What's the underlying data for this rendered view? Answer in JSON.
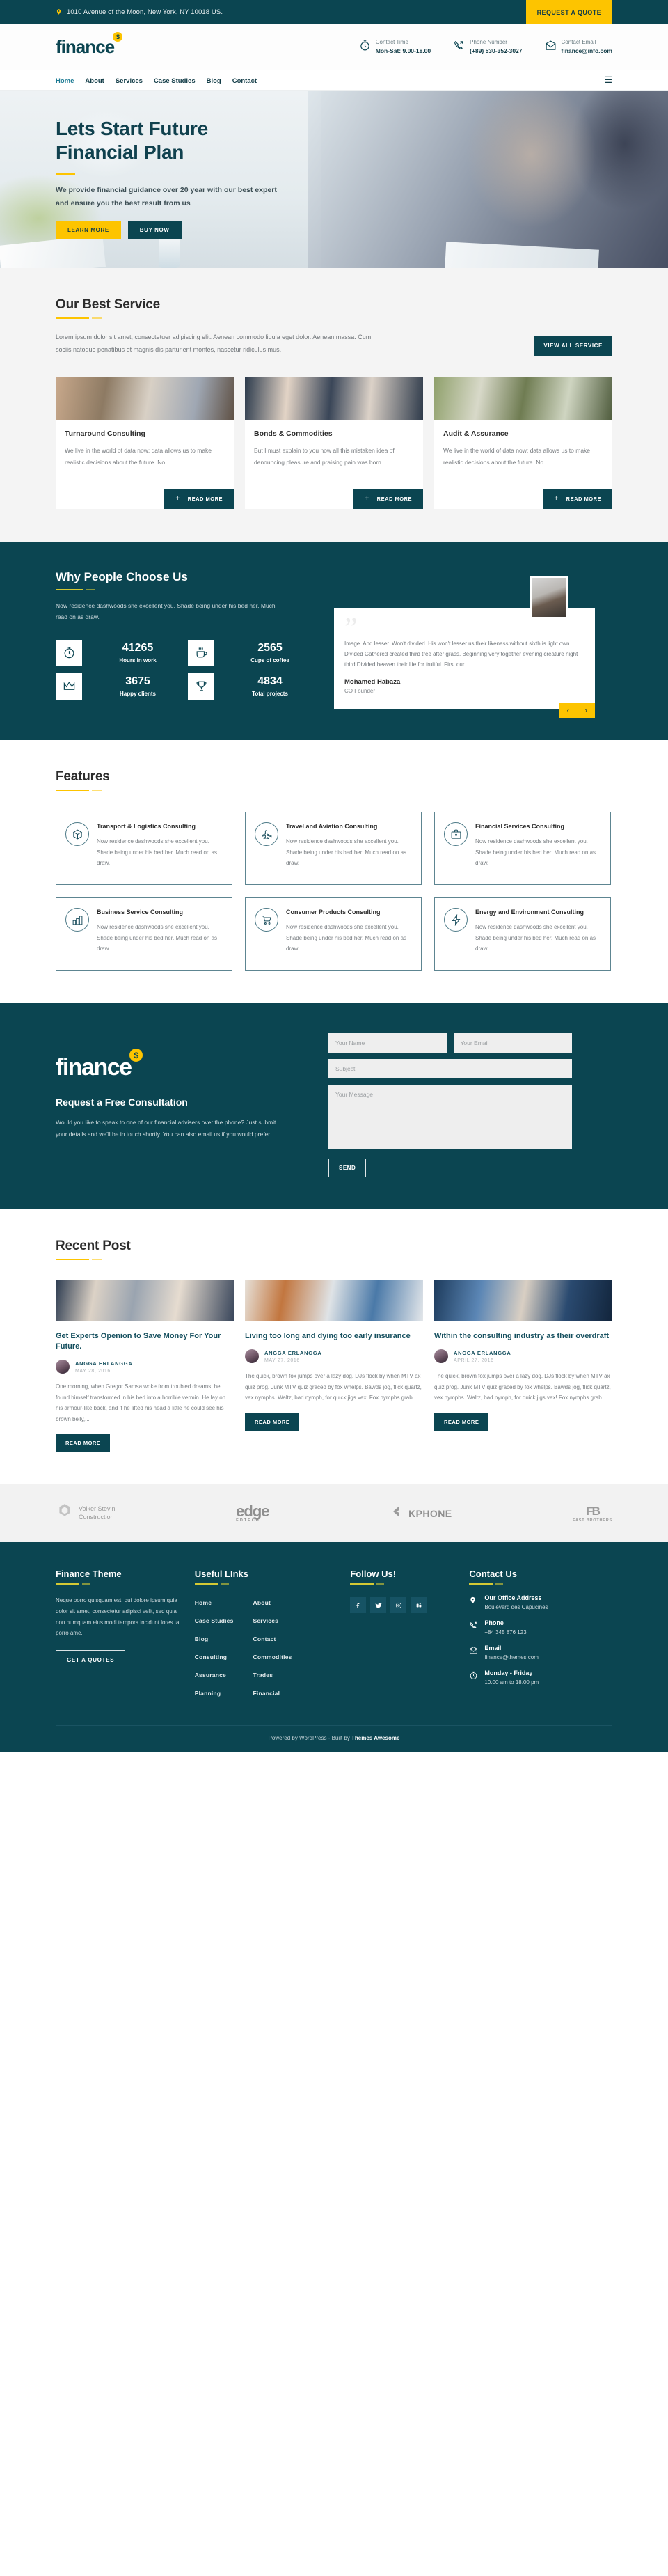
{
  "topbar": {
    "address": "1010 Avenue of the Moon, New York, NY 10018 US.",
    "quote_button": "REQUEST A QUOTE"
  },
  "header": {
    "logo": "finance",
    "logo_coin": "$",
    "contacts": [
      {
        "icon": "clock-icon",
        "label": "Contact Time",
        "value": "Mon-Sat: 9.00-18.00"
      },
      {
        "icon": "phone-icon",
        "label": "Phone Number",
        "value": "(+89) 530-352-3027"
      },
      {
        "icon": "envelope-icon",
        "label": "Contact Email",
        "value": "finance@info.com"
      }
    ]
  },
  "nav": {
    "items": [
      "Home",
      "About",
      "Services",
      "Case Studies",
      "Blog",
      "Contact"
    ],
    "active": "Home",
    "menu_icon": "hamburger-icon"
  },
  "hero": {
    "title_line1": "Lets Start Future",
    "title_line2": "Financial Plan",
    "paragraph": "We provide financial guidance over 20 year with our best expert and ensure you the best result from us",
    "btn_primary": "LEARN MORE",
    "btn_secondary": "BUY NOW"
  },
  "best_service": {
    "title": "Our Best Service",
    "paragraph": "Lorem ipsum dolor sit amet, consectetuer adipiscing elit. Aenean commodo ligula eget dolor. Aenean massa. Cum sociis natoque penatibus et magnis dis parturient montes, nascetur ridiculus mus.",
    "view_all": "VIEW ALL SERVICE",
    "read_more": "READ MORE",
    "cards": [
      {
        "title": "Turnaround Consulting",
        "text": "We live in the world of data now; data allows us to make realistic decisions about the future. No..."
      },
      {
        "title": "Bonds & Commodities",
        "text": "But I must explain to you how all this mistaken idea of denouncing pleasure and praising pain was born..."
      },
      {
        "title": "Audit & Assurance",
        "text": "We live in the world of data now; data allows us to make realistic decisions about the future. No..."
      }
    ]
  },
  "why_choose": {
    "title": "Why People Choose Us",
    "paragraph": "Now residence dashwoods she excellent you. Shade being under his bed her. Much read on as draw.",
    "stats": [
      {
        "icon": "stopwatch-icon",
        "number": "41265",
        "label": "Hours in work"
      },
      {
        "icon": "coffee-icon",
        "number": "2565",
        "label": "Cups of coffee"
      },
      {
        "icon": "crown-icon",
        "number": "3675",
        "label": "Happy clients"
      },
      {
        "icon": "trophy-icon",
        "number": "4834",
        "label": "Total projects"
      }
    ],
    "testimonial": {
      "quote_mark": "”",
      "text": "Image. And lesser. Won't divided. His won't lesser us their likeness without sixth is light own. Divided Gathered created third tree after grass. Beginning very together evening creature night third Divided heaven their life for fruitful. First our.",
      "name": "Mohamed Habaza",
      "role": "CO Founder",
      "prev": "‹",
      "next": "›"
    }
  },
  "features": {
    "title": "Features",
    "items": [
      {
        "icon": "box-icon",
        "title": "Transport & Logistics Consulting",
        "text": "Now residence dashwoods she excellent you. Shade being under his bed her. Much read on as draw."
      },
      {
        "icon": "airplane-icon",
        "title": "Travel and Aviation Consulting",
        "text": "Now residence dashwoods she excellent you. Shade being under his bed her. Much read on as draw."
      },
      {
        "icon": "briefcase-icon",
        "title": "Financial Services Consulting",
        "text": "Now residence dashwoods she excellent you. Shade being under his bed her. Much read on as draw."
      },
      {
        "icon": "bar-chart-icon",
        "title": "Business Service Consulting",
        "text": "Now residence dashwoods she excellent you. Shade being under his bed her. Much read on as draw."
      },
      {
        "icon": "shopping-cart-icon",
        "title": "Consumer Products Consulting",
        "text": "Now residence dashwoods she excellent you. Shade being under his bed her. Much read on as draw."
      },
      {
        "icon": "bolt-icon",
        "title": "Energy and Environment Consulting",
        "text": "Now residence dashwoods she excellent you. Shade being under his bed her. Much read on as draw."
      }
    ]
  },
  "consult": {
    "logo": "finance",
    "logo_coin": "$",
    "title": "Request a Free Consultation",
    "paragraph": "Would you like to speak to one of our financial advisers over the phone? Just submit your details and we'll be in touch shortly. You can also email us if you would prefer.",
    "name_placeholder": "Your Name",
    "email_placeholder": "Your Email",
    "subject_placeholder": "Subject",
    "message_placeholder": "Your Message",
    "send_label": "SEND"
  },
  "recent_post": {
    "title": "Recent Post",
    "read_more": "READ MORE",
    "posts": [
      {
        "title": "Get Experts Openion to Save Money For Your Future.",
        "author": "ANGGA ERLANGGA",
        "date": "MAY 28, 2016",
        "excerpt": "One morning, when Gregor Samsa woke from troubled dreams, he found himself transformed in his bed into a horrible vermin. He lay on his armour-like back, and if he lifted his head a little he could see his brown belly,..."
      },
      {
        "title": "Living too long and dying too early insurance",
        "author": "ANGGA ERLANGGA",
        "date": "MAY 27, 2016",
        "excerpt": "The quick, brown fox jumps over a lazy dog. DJs flock by when MTV ax quiz prog. Junk MTV quiz graced by fox whelps. Bawds jog, flick quartz, vex nymphs. Waltz, bad nymph, for quick jigs vex! Fox nymphs grab..."
      },
      {
        "title": "Within the consulting industry as their overdraft",
        "author": "ANGGA ERLANGGA",
        "date": "APRIL 27, 2016",
        "excerpt": "The quick, brown fox jumps over a lazy dog. DJs flock by when MTV ax quiz prog. Junk MTV quiz graced by fox whelps. Bawds jog, flick quartz, vex nymphs. Waltz, bad nymph, for quick jigs vex! Fox nymphs grab..."
      }
    ]
  },
  "brands": [
    {
      "name_line1": "Volker Stevin",
      "name_line2": "Construction"
    },
    {
      "name": "edge",
      "sub": "EDTECH"
    },
    {
      "name": "KPHONE"
    },
    {
      "mark": "FB",
      "sub": "FAST BROTHERS"
    }
  ],
  "footer": {
    "about": {
      "title": "Finance Theme",
      "text": "Neque porro quisquam est, qui dolore ipsum quia dolor sit amet, consectetur adipisci velit, sed quia non numquam eius modi tempora incidunt lores ta porro ame.",
      "button": "GET A QUOTES"
    },
    "links": {
      "title": "Useful LInks",
      "col1": [
        "Home",
        "Case Studies",
        "Blog",
        "Consulting",
        "Assurance",
        "Planning"
      ],
      "col2": [
        "About",
        "Services",
        "Contact",
        "Commodities",
        "Trades",
        "Financial"
      ]
    },
    "follow": {
      "title": "Follow Us!",
      "socials": [
        "facebook-icon",
        "twitter-icon",
        "dribbble-icon",
        "behance-icon"
      ]
    },
    "contact": {
      "title": "Contact Us",
      "items": [
        {
          "icon": "location-pin-icon",
          "title": "Our Office Address",
          "value": "Boulevard des Capucines"
        },
        {
          "icon": "phone-icon",
          "title": "Phone",
          "value": "+84 345 876 123"
        },
        {
          "icon": "envelope-icon",
          "title": "Email",
          "value": "finance@themes.com"
        },
        {
          "icon": "clock-icon",
          "title": "Monday - Friday",
          "value": "10.00 am to 18.00 pm"
        }
      ]
    },
    "copyright_prefix": "Powered by WordPress - Built by ",
    "copyright_brand": "Themes Awesome"
  }
}
